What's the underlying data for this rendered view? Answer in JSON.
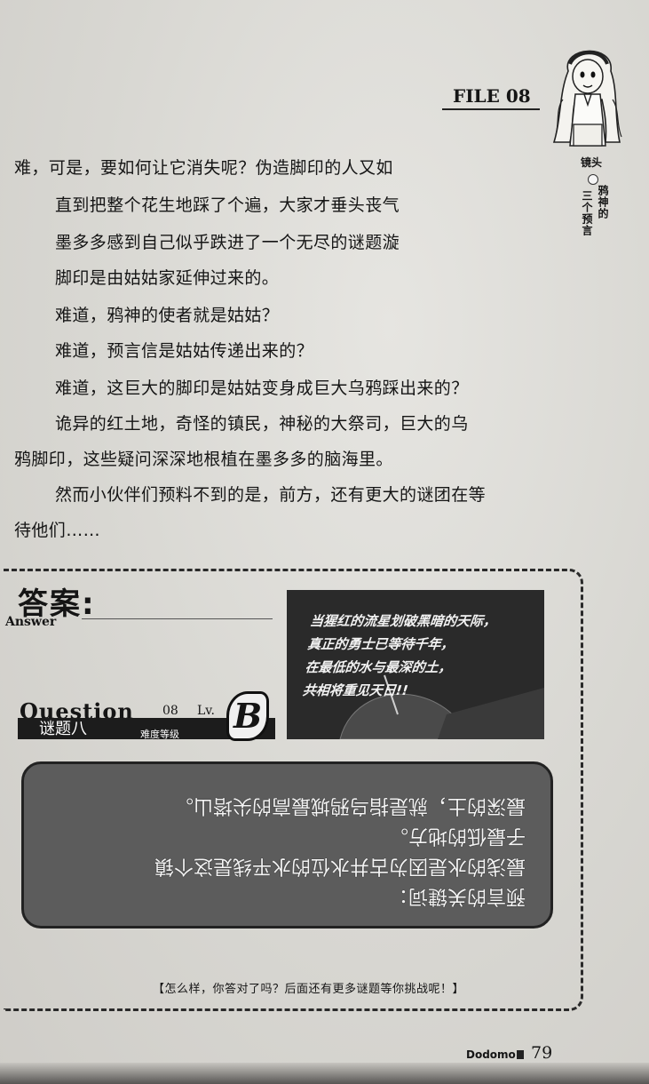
{
  "header": {
    "file_label": "FILE 08"
  },
  "side": {
    "line1": "镜头",
    "line2": "三个预言",
    "line3": "鸦神的"
  },
  "paragraphs": [
    "难，可是，要如何让它消失呢？伪造脚印的人又如",
    "直到把整个花生地踩了个遍，大家才垂头丧气",
    "墨多多感到自己似乎跌进了一个无尽的谜题漩",
    "脚印是由姑姑家延伸过来的。",
    "难道，鸦神的使者就是姑姑？",
    "难道，预言信是姑姑传递出来的？",
    "难道，这巨大的脚印是姑姑变身成巨大乌鸦踩出来的？",
    "诡异的红土地，奇怪的镇民，神秘的大祭司，巨大的乌",
    "鸦脚印，这些疑问深深地根植在墨多多的脑海里。",
    "然而小伙伴们预料不到的是，前方，还有更大的谜团在等",
    "待他们……"
  ],
  "answer": {
    "title": "答案:",
    "subtitle": "Answer"
  },
  "illustration": {
    "lines": [
      "当猩红的流星划破黑暗的天际，",
      "真正的勇士已等待千年，",
      "在最低的水与最深的土，",
      "共相将重见天日!!"
    ]
  },
  "question": {
    "word": "Question",
    "number": "08",
    "level_prefix": "Lv.",
    "grade": "B",
    "title_zh": "谜题八",
    "difficulty_label": "难度等级"
  },
  "hint": {
    "lines": [
      "预言的关键词：",
      "最浅的水是因为古井水位的水平线是这个镇",
      "子最低的地方。",
      "最深的土，就是指乌鸦城最高的尖塔山。"
    ]
  },
  "footer": {
    "note": "【怎么样，你答对了吗？后面还有更多谜题等你挑战呢！】",
    "brand": "Dodomo",
    "page_number": "79"
  }
}
